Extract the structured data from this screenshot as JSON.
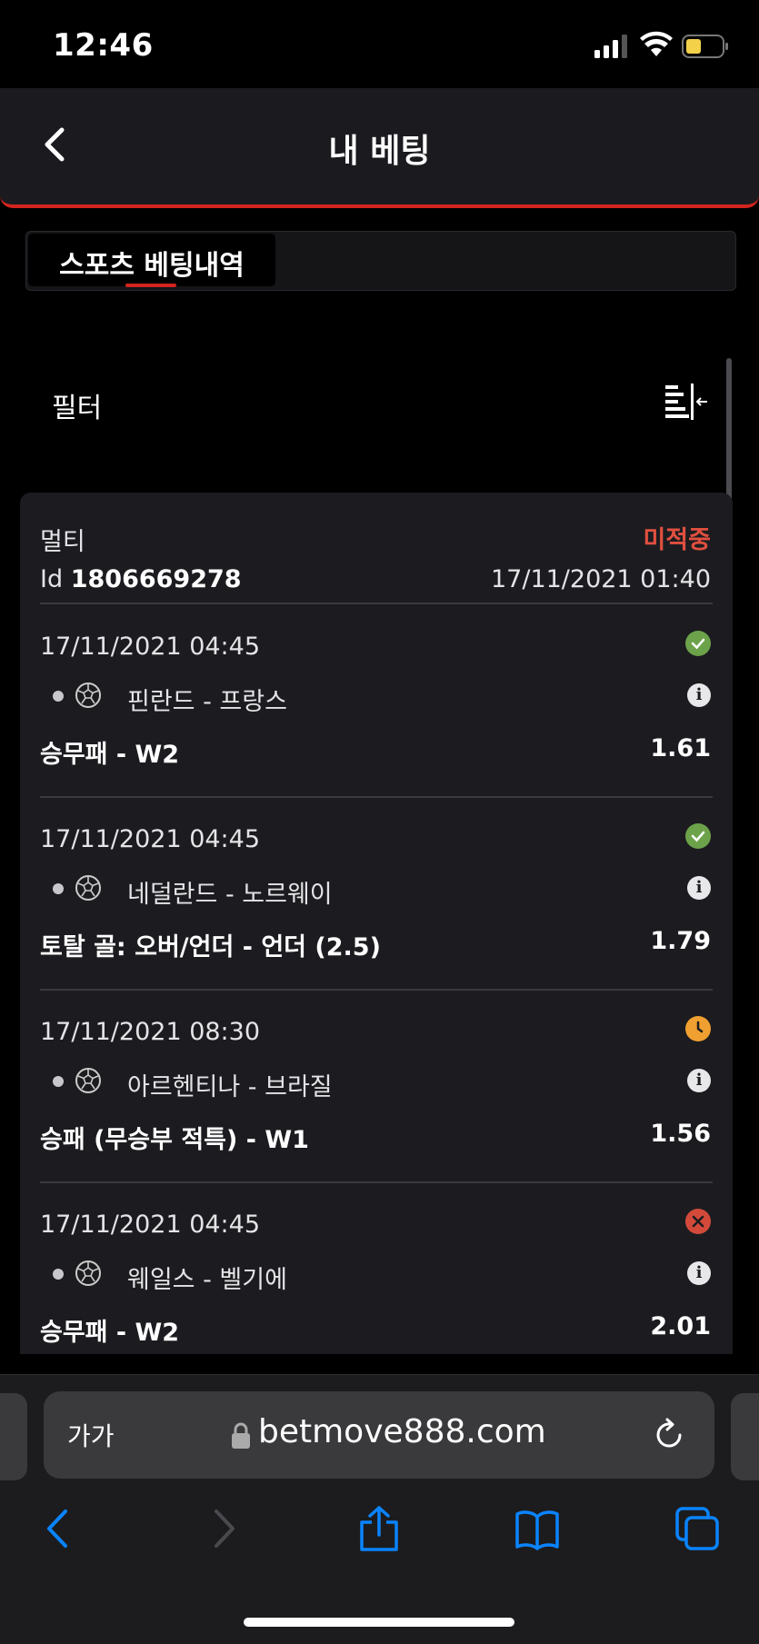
{
  "status_bar": {
    "time": "12:46"
  },
  "header": {
    "title": "내 베팅"
  },
  "tabs": [
    {
      "label": "스포츠 베팅내역",
      "active": true
    }
  ],
  "filter": {
    "label": "필터"
  },
  "bet": {
    "type": "멀티",
    "status": "미적중",
    "id_prefix": "Id",
    "id": "1806669278",
    "placed_at": "17/11/2021 01:40",
    "events": [
      {
        "date": "17/11/2021 04:45",
        "result": "won",
        "match": "핀란드 - 프랑스",
        "market": "승무패 - W2",
        "odds": "1.61"
      },
      {
        "date": "17/11/2021 04:45",
        "result": "won",
        "match": "네덜란드 - 노르웨이",
        "market": "토탈 골: 오버/언더 - 언더 (2.5)",
        "odds": "1.79"
      },
      {
        "date": "17/11/2021 08:30",
        "result": "pending",
        "match": "아르헨티나 - 브라질",
        "market": "승패 (무승부 적특) - W1",
        "odds": "1.56"
      },
      {
        "date": "17/11/2021 04:45",
        "result": "lost",
        "match": "웨일스 - 벨기에",
        "market": "승무패 - W2",
        "odds": "2.01"
      }
    ]
  },
  "browser": {
    "text_size": "가가",
    "url": "betmove888.com"
  },
  "icons": {
    "won": "check-circle-icon",
    "pending": "clock-icon",
    "lost": "x-circle-icon",
    "info": "info-icon",
    "sport": "soccer-ball-icon"
  },
  "colors": {
    "accent": "#d3241f",
    "lost_status": "#e0503f",
    "won": "#6ca24a",
    "pending": "#f0a030",
    "ios_blue": "#0a84ff"
  }
}
